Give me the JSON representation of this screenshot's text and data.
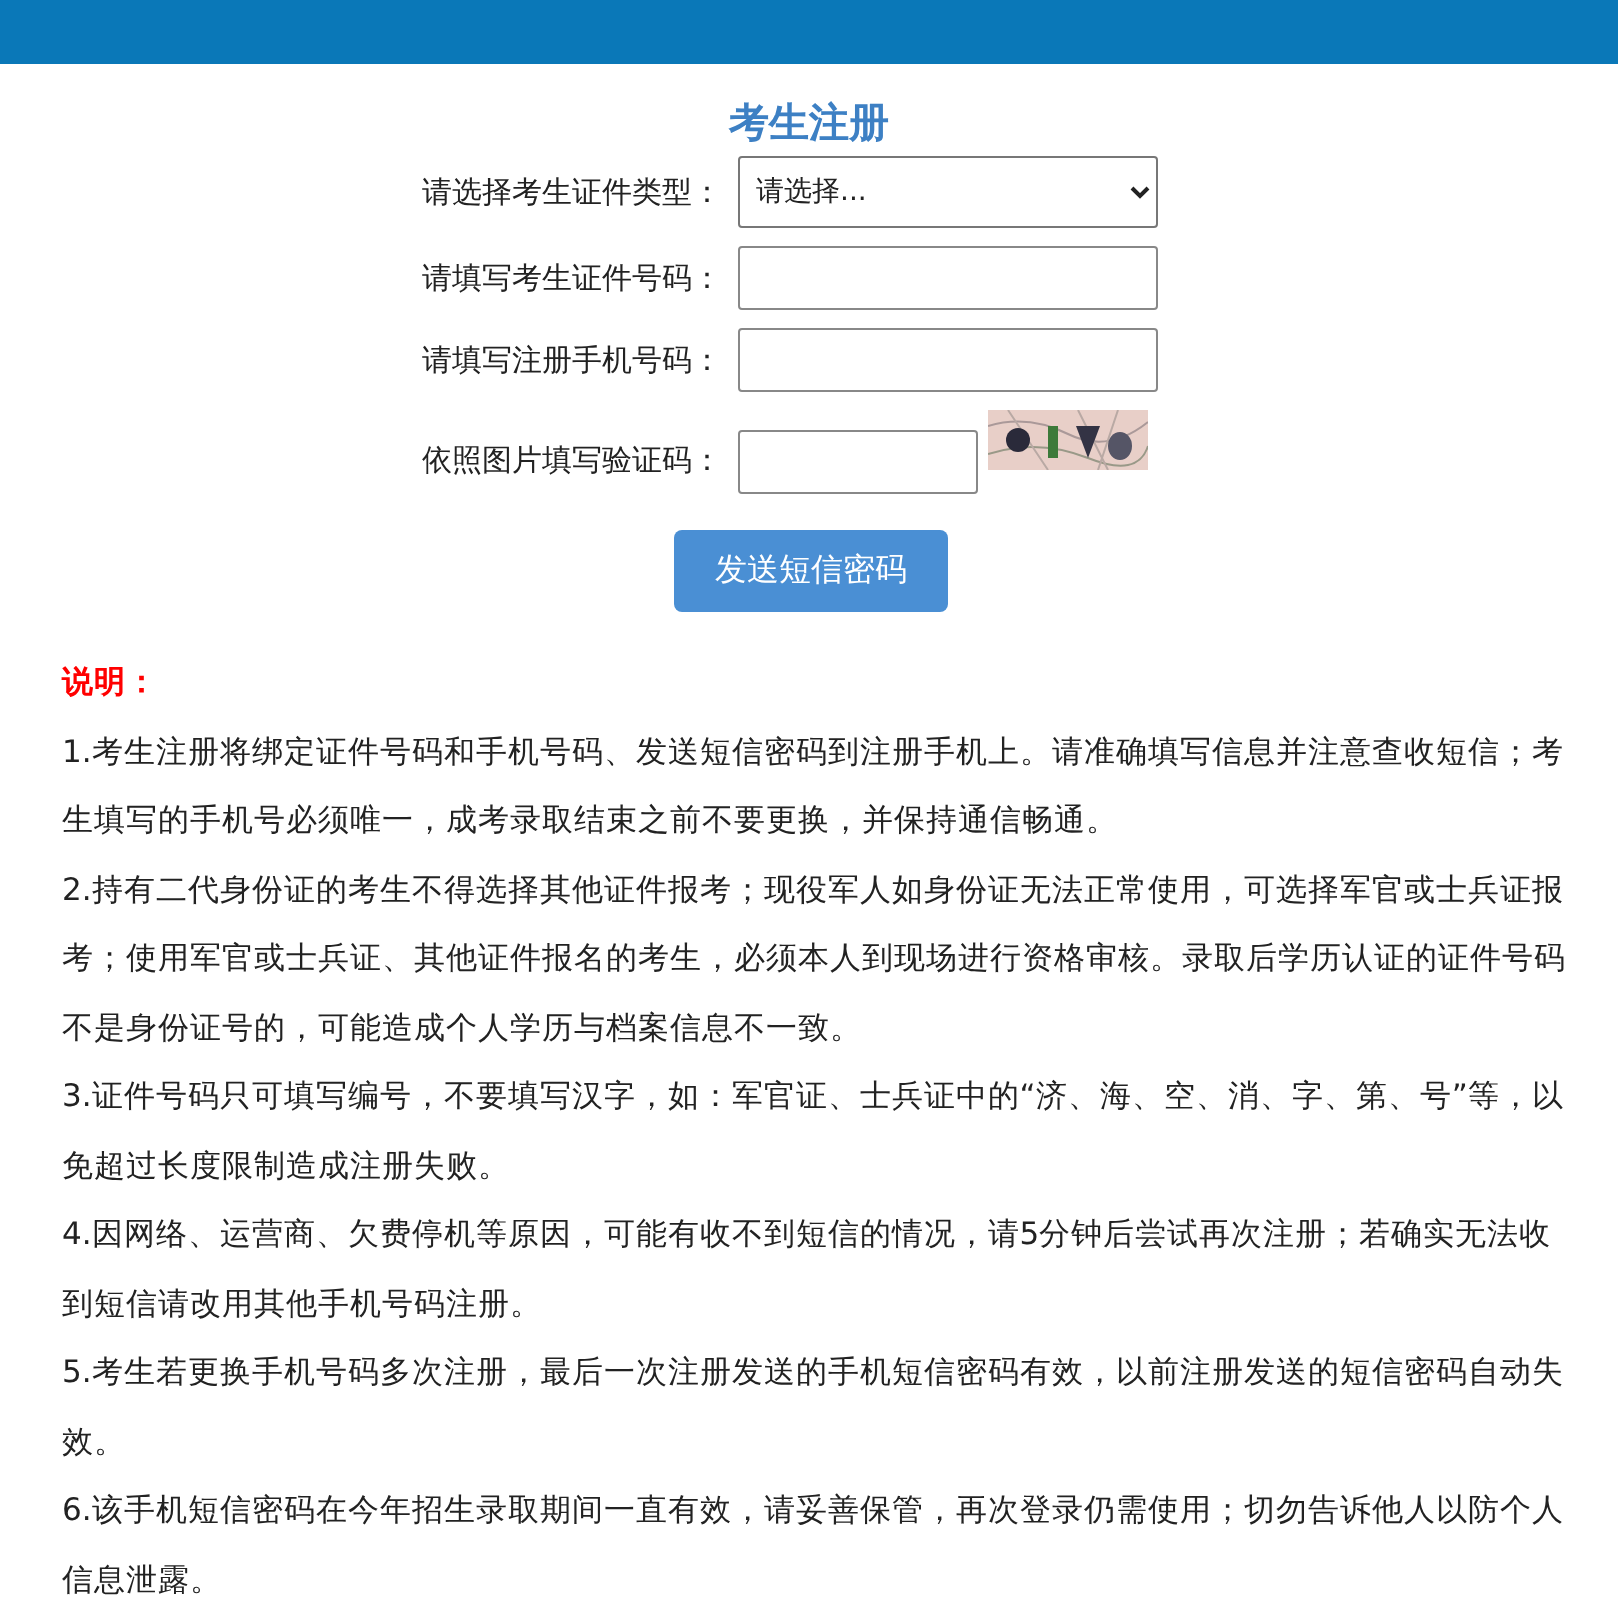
{
  "title": "考生注册",
  "form": {
    "fields": [
      {
        "kind": "select",
        "label": "请选择考生证件类型：",
        "value": "请选择..."
      },
      {
        "kind": "text",
        "label": "请填写考生证件号码："
      },
      {
        "kind": "text",
        "label": "请填写注册手机号码："
      },
      {
        "kind": "captcha",
        "label": "依照图片填写验证码："
      }
    ],
    "submit": "发送短信密码"
  },
  "notes": {
    "heading": "说明：",
    "items": [
      "1.考生注册将绑定证件号码和手机号码、发送短信密码到注册手机上。请准确填写信息并注意查收短信；考生填写的手机号必须唯一，成考录取结束之前不要更换，并保持通信畅通。",
      "2.持有二代身份证的考生不得选择其他证件报考；现役军人如身份证无法正常使用，可选择军官或士兵证报考；使用军官或士兵证、其他证件报名的考生，必须本人到现场进行资格审核。录取后学历认证的证件号码不是身份证号的，可能造成个人学历与档案信息不一致。",
      "3.证件号码只可填写编号，不要填写汉字，如：军官证、士兵证中的“济、海、空、消、字、第、号”等，以免超过长度限制造成注册失败。",
      "4.因网络、运营商、欠费停机等原因，可能有收不到短信的情况，请5分钟后尝试再次注册；若确实无法收到短信请改用其他手机号码注册。",
      "5.考生若更换手机号码多次注册，最后一次注册发送的手机短信密码有效，以前注册发送的短信密码自动失效。",
      "6.该手机短信密码在今年招生录取期间一直有效，请妥善保管，再次登录仍需使用；切勿告诉他人以防个人信息泄露。"
    ]
  }
}
